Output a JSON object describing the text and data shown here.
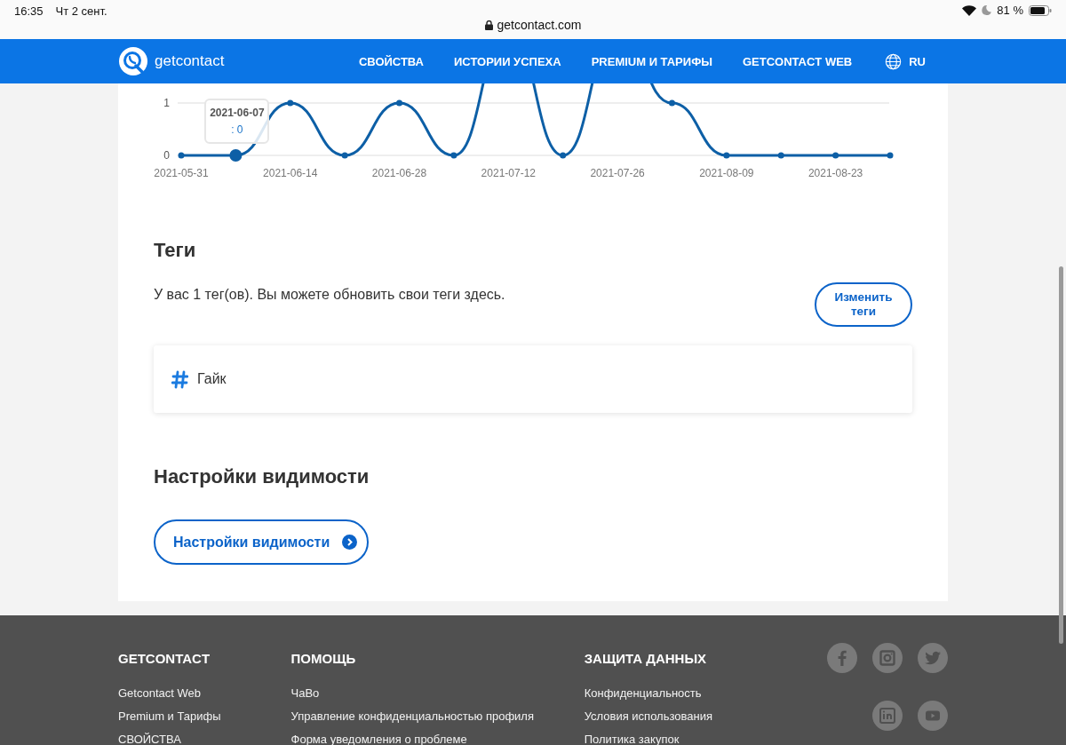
{
  "status_bar": {
    "time": "16:35",
    "date": "Чт 2 сент.",
    "url": "getcontact.com",
    "battery": "81 %"
  },
  "header": {
    "logo": "getcontact",
    "nav": [
      "СВОЙСТВА",
      "ИСТОРИИ УСПЕХА",
      "PREMIUM И ТАРИФЫ",
      "GETCONTACT WEB"
    ],
    "language": "RU"
  },
  "activity": {
    "chart_data": {
      "type": "line",
      "marker": true,
      "categories": [
        "2021-05-31",
        null,
        "2021-06-14",
        null,
        "2021-06-28",
        null,
        "2021-07-12",
        null,
        "2021-07-26",
        null,
        "2021-08-09",
        null,
        "2021-08-23",
        null
      ],
      "values": [
        0,
        0,
        1,
        0,
        1,
        0,
        null,
        0,
        null,
        1,
        0,
        0,
        0,
        0
      ],
      "ylim": [
        0,
        1
      ],
      "yticks": [
        0,
        1
      ]
    },
    "points": [
      {
        "selected": false
      },
      {
        "selected": true
      },
      {
        "selected": false
      },
      {
        "selected": false
      },
      {
        "selected": false
      },
      {
        "selected": false
      },
      {
        "selected": false
      },
      {
        "selected": false
      },
      {
        "selected": false
      },
      {
        "selected": false
      },
      {
        "selected": false
      },
      {
        "selected": false
      }
    ],
    "tooltip": {
      "date": "2021-06-07",
      "value": ": 0"
    }
  },
  "tags": {
    "title": "Теги",
    "description": "У вас 1 тег(ов). Вы можете обновить свои теги здесь.",
    "edit_button": "Изменить теги",
    "items": [
      "Гайк"
    ]
  },
  "visibility": {
    "title": "Настройки видимости",
    "button": "Настройки видимости"
  },
  "footer": {
    "columns": [
      {
        "title": "GETCONTACT",
        "links": [
          "Getcontact Web",
          "Premium и Тарифы",
          "СВОЙСТВА"
        ]
      },
      {
        "title": "ПОМОЩЬ",
        "links": [
          "ЧаВо",
          "Управление конфиденциальностью профиля",
          "Форма уведомления о проблеме"
        ]
      },
      {
        "title": "ЗАЩИТА ДАННЫХ",
        "links": [
          "Конфиденциальность",
          "Условия использования",
          "Политика закупок"
        ]
      }
    ]
  }
}
